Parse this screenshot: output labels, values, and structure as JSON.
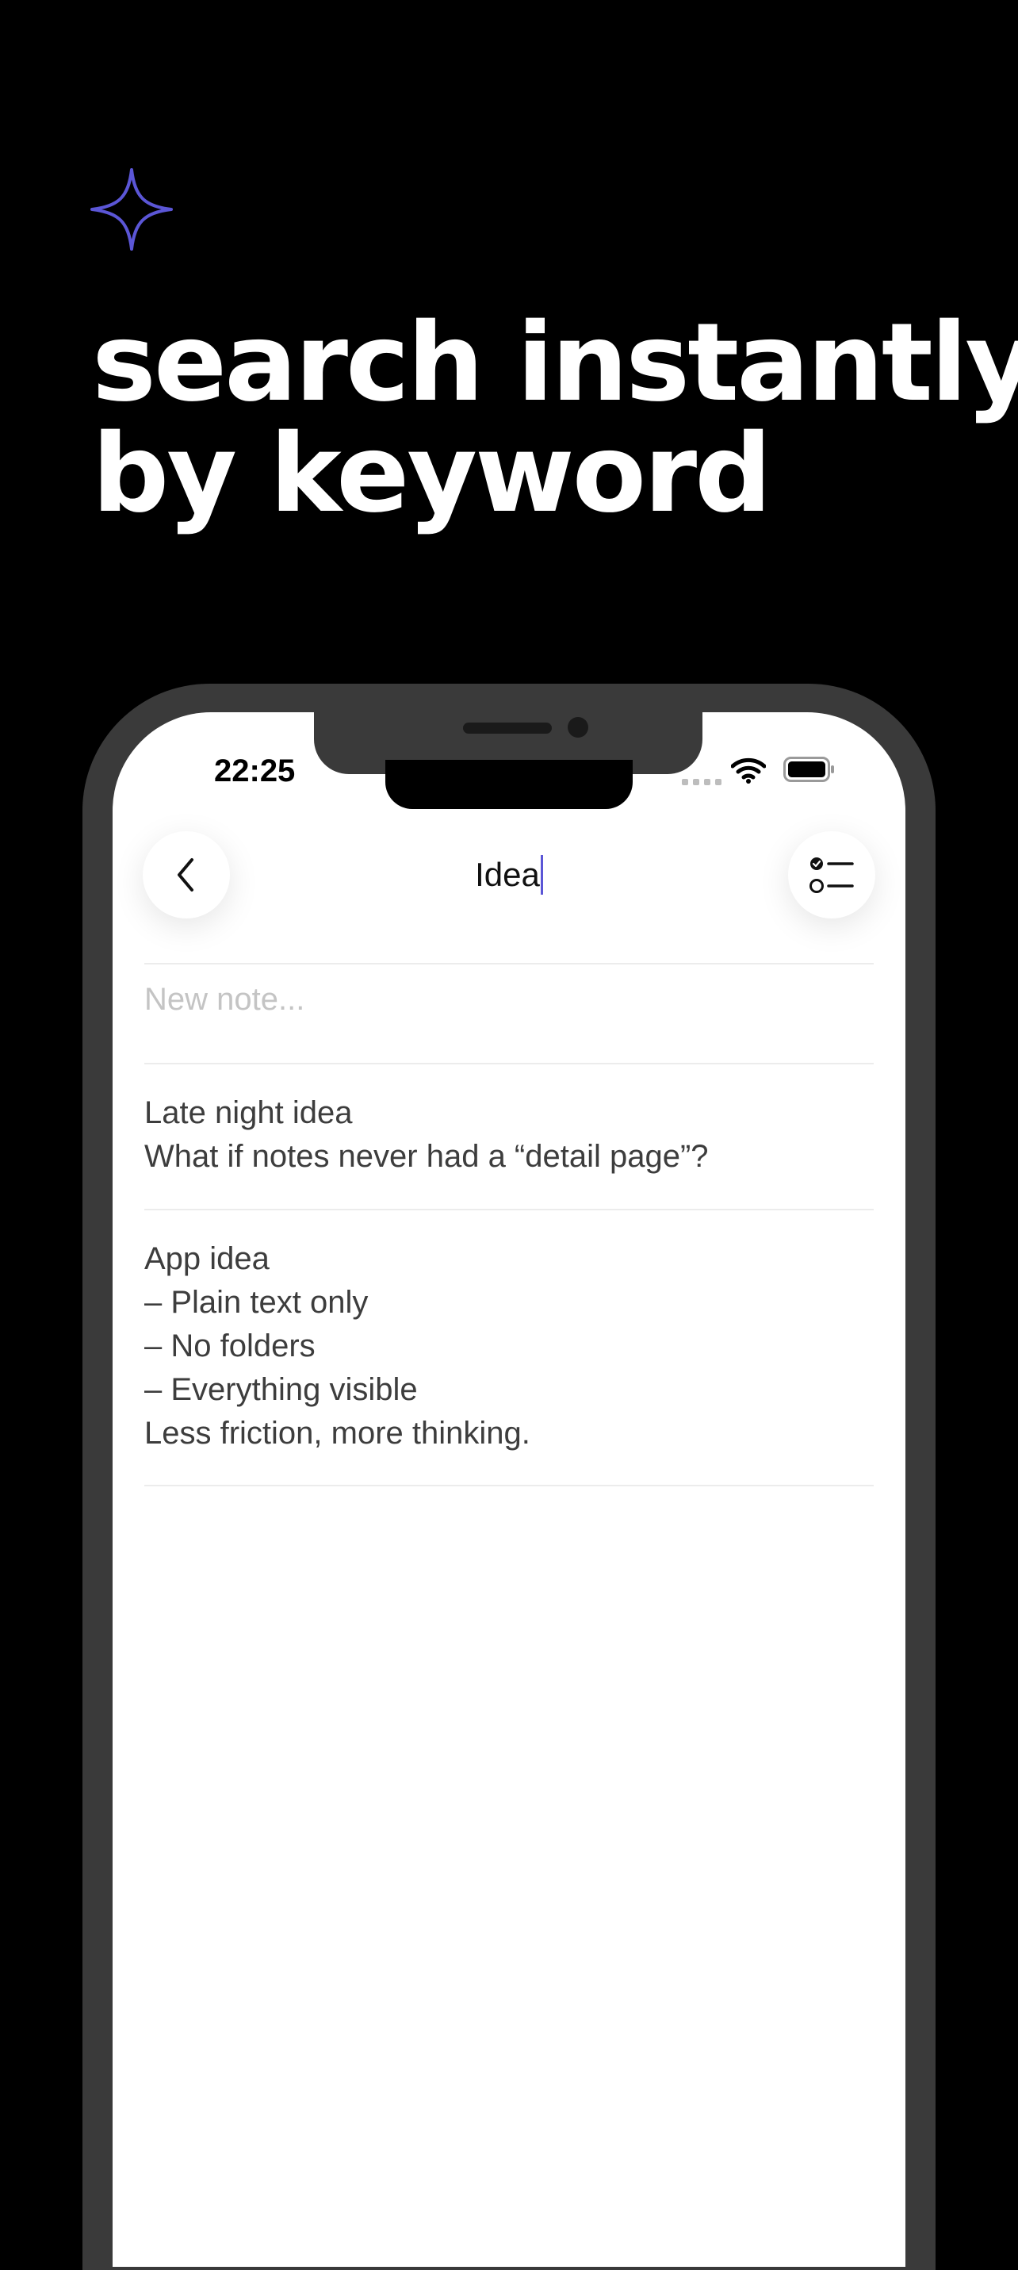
{
  "colors": {
    "background": "#000000",
    "accent": "#5b56d6",
    "headline": "#ffffff",
    "phone_frame": "#3a3a3a",
    "placeholder": "#c4c4c4",
    "note_text": "#3d3d3d"
  },
  "headline": {
    "line1": "search instantly",
    "line2": "by keyword"
  },
  "status_bar": {
    "time": "22:25",
    "icons": [
      "signal-icon",
      "wifi-icon",
      "battery-icon"
    ]
  },
  "nav": {
    "back_icon": "chevron-left-icon",
    "search_value": "Idea",
    "list_icon": "checklist-icon"
  },
  "new_note": {
    "placeholder": "New note..."
  },
  "notes": [
    {
      "lines": [
        "Late night idea",
        "What if notes never had a “detail page”?"
      ]
    },
    {
      "lines": [
        "App idea",
        "– Plain text only",
        "– No folders",
        "– Everything visible",
        "Less friction, more thinking."
      ]
    }
  ]
}
